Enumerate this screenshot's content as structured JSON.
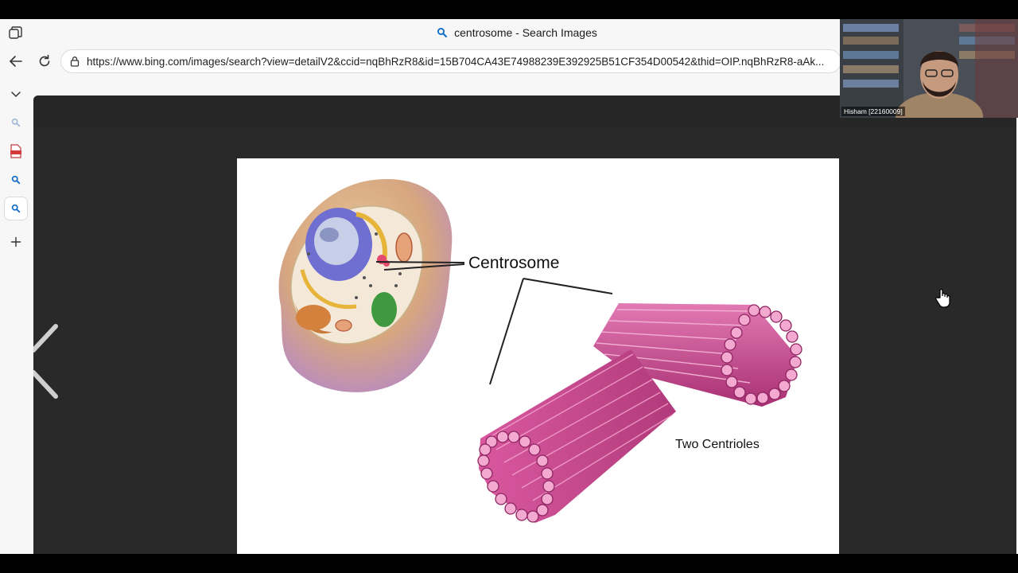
{
  "browser": {
    "tab_title": "centrosome - Search Images",
    "address": "https://www.bing.com/images/search?view=detailV2&ccid=nqBhRzR8&id=15B704CA43E74988239E392925B51CF354D00542&thid=OIP.nqBhRzR8-aAk...",
    "icons": {
      "tab_actions": "tab-actions-icon",
      "search": "search-icon",
      "back": "back-arrow-icon",
      "refresh": "refresh-icon",
      "lock": "lock-icon"
    }
  },
  "sidebar": {
    "items": [
      {
        "name": "collapse",
        "icon": "chevron-down-icon"
      },
      {
        "name": "search-faded",
        "icon": "search-icon"
      },
      {
        "name": "pdf-tab",
        "icon": "pdf-icon"
      },
      {
        "name": "search-tab",
        "icon": "search-icon"
      },
      {
        "name": "search-tab-active",
        "icon": "search-icon"
      },
      {
        "name": "new-tab",
        "icon": "plus-icon"
      }
    ]
  },
  "image": {
    "label_centrosome": "Centrosome",
    "label_centrioles": "Two Centrioles"
  },
  "webcam": {
    "participant": "Hisham [22160009]"
  },
  "colors": {
    "accent_blue": "#0a68c7",
    "viewer_bg": "#292929",
    "centriole_pink": "#c2408a"
  }
}
